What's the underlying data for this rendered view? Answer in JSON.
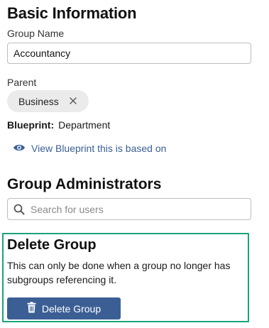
{
  "basic_info": {
    "heading": "Basic Information",
    "group_name_label": "Group Name",
    "group_name_value": "Accountancy",
    "parent_label": "Parent",
    "parent_chip": "Business",
    "blueprint_label": "Blueprint:",
    "blueprint_value": "Department",
    "view_blueprint_link": "View Blueprint this is based on"
  },
  "administrators": {
    "heading": "Group Administrators",
    "search_placeholder": "Search for users"
  },
  "delete_group": {
    "heading": "Delete Group",
    "description": "This can only be done when a group no longer has subgroups referencing it.",
    "button_label": "Delete Group"
  },
  "colors": {
    "accent": "#3b5f95",
    "link": "#3a5f94",
    "highlight_border": "#1aa37a",
    "chip_bg": "#ebebeb"
  },
  "icons": {
    "chip_remove": "close-icon",
    "view_link": "eye-icon",
    "search": "search-icon",
    "delete_button": "trash-icon"
  }
}
